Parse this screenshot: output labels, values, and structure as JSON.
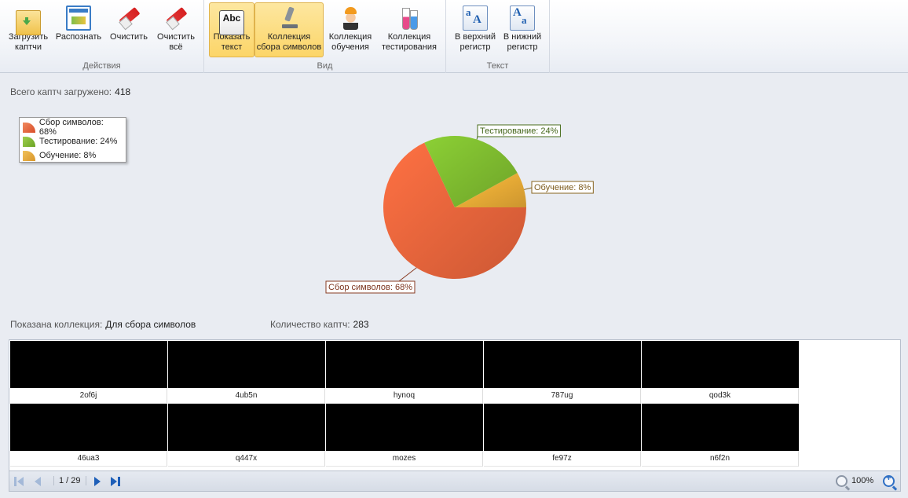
{
  "ribbon": {
    "groups": [
      {
        "label": "Действия"
      },
      {
        "label": "Вид"
      },
      {
        "label": "Текст"
      }
    ],
    "buttons": {
      "load": "Загрузить\nкаптчи",
      "recognize": "Распознать",
      "clear": "Очистить",
      "clear_all": "Очистить\nвсё",
      "show_text": "Показать\nтекст",
      "show_text_icon": "Abc",
      "collection_symbols": "Коллекция\nсбора символов",
      "collection_training": "Коллекция\nобучения",
      "collection_testing": "Коллекция\nтестирования",
      "upper_case": "В верхний\nрегистр",
      "lower_case": "В нижний\nрегистр"
    }
  },
  "summary": {
    "total_label": "Всего каптч загружено:",
    "total_value": "418"
  },
  "chart_data": {
    "type": "pie",
    "slices": [
      {
        "name": "Сбор символов",
        "value": 68,
        "color": "#e3623a",
        "label": "Сбор символов: 68%",
        "legend": "Сбор символов: 68%"
      },
      {
        "name": "Тестирование",
        "value": 24,
        "color": "#7ab52e",
        "label": "Тестирование: 24%",
        "legend": "Тестирование: 24%"
      },
      {
        "name": "Обучение",
        "value": 8,
        "color": "#e3a634",
        "label": "Обучение: 8%",
        "legend": "Обучение: 8%"
      }
    ],
    "legend_position": "top-left"
  },
  "collection": {
    "shown_label": "Показана коллекция:",
    "shown_value": "Для сбора символов",
    "count_label": "Количество каптч:",
    "count_value": "283"
  },
  "captchas": [
    "2of6j",
    "4ub5n",
    "hynoq",
    "787ug",
    "qod3k",
    "46ua3",
    "q447x",
    "mozes",
    "fe97z",
    "n6f2n"
  ],
  "pager": {
    "text": "1 / 29",
    "zoom": "100%"
  },
  "colors": {
    "accent_active": "#fcd568",
    "slice_symbols": "#e3623a",
    "slice_testing": "#7ab52e",
    "slice_training": "#e3a634"
  }
}
